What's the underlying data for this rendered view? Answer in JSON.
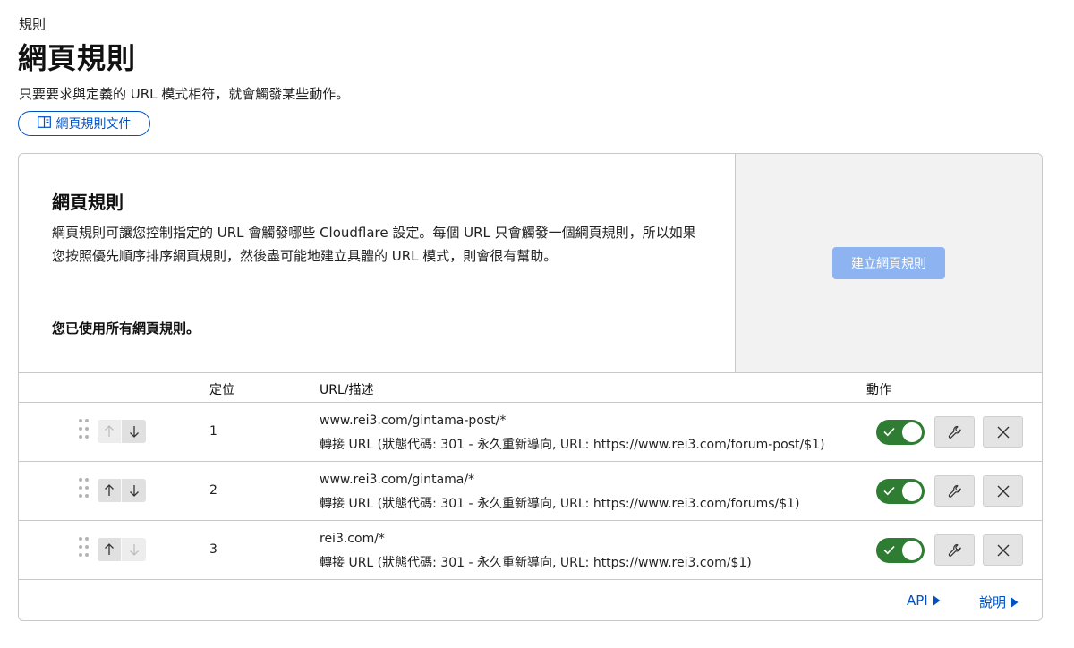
{
  "header": {
    "breadcrumb": "規則",
    "title": "網頁規則",
    "subtitle": "只要要求與定義的 URL 模式相符，就會觸發某些動作。",
    "doc_button_label": "網頁規則文件"
  },
  "info": {
    "title": "網頁規則",
    "description": "網頁規則可讓您控制指定的 URL 會觸發哪些 Cloudflare 設定。每個 URL 只會觸發一個網頁規則，所以如果您按照優先順序排序網頁規則，然後盡可能地建立具體的 URL 模式，則會很有幫助。",
    "note": "您已使用所有網頁規則。",
    "create_button_label": "建立網頁規則"
  },
  "table": {
    "headers": {
      "position": "定位",
      "url": "URL/描述",
      "actions": "動作"
    },
    "rows": [
      {
        "position": "1",
        "url": "www.rei3.com/gintama-post/*",
        "description": "轉接 URL (狀態代碼: 301 - 永久重新導向, URL: https://www.rei3.com/forum-post/$1)",
        "enabled": true,
        "up_disabled": true,
        "down_disabled": false
      },
      {
        "position": "2",
        "url": "www.rei3.com/gintama/*",
        "description": "轉接 URL (狀態代碼: 301 - 永久重新導向, URL: https://www.rei3.com/forums/$1)",
        "enabled": true,
        "up_disabled": false,
        "down_disabled": false
      },
      {
        "position": "3",
        "url": "rei3.com/*",
        "description": "轉接 URL (狀態代碼: 301 - 永久重新導向, URL: https://www.rei3.com/$1)",
        "enabled": true,
        "up_disabled": false,
        "down_disabled": true
      }
    ]
  },
  "footer": {
    "api_label": "API",
    "help_label": "說明"
  },
  "colors": {
    "accent": "#0051c3",
    "toggle_on": "#2e7d32",
    "create_button_disabled": "#8db4f0"
  },
  "icons": {
    "doc_button": "book-icon",
    "drag": "drag-handle-icon",
    "up": "arrow-up-icon",
    "down": "arrow-down-icon",
    "toggle_check": "check-icon",
    "edit": "wrench-icon",
    "delete": "close-icon",
    "footer_links": "caret-right-icon"
  }
}
